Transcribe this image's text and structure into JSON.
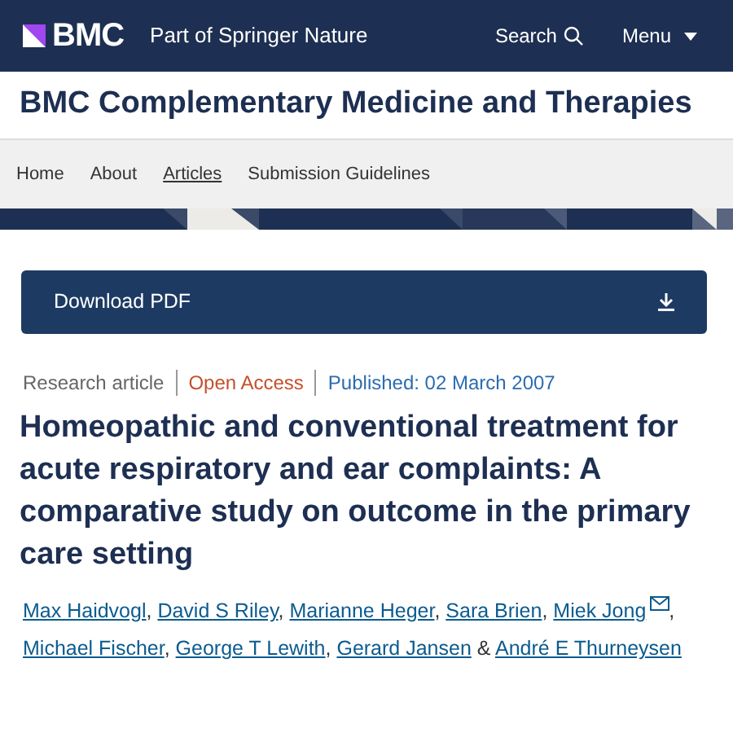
{
  "header": {
    "logo": "BMC",
    "tagline": "Part of Springer Nature",
    "search": "Search",
    "menu": "Menu"
  },
  "journal_title": "BMC Complementary Medicine and Therapies",
  "nav": [
    {
      "label": "Home",
      "selected": false
    },
    {
      "label": "About",
      "selected": false
    },
    {
      "label": "Articles",
      "selected": true
    },
    {
      "label": "Submission Guidelines",
      "selected": false
    }
  ],
  "download_button": "Download PDF",
  "meta": [
    {
      "kind": "type",
      "text": "Research article"
    },
    {
      "kind": "access",
      "text": "Open Access"
    },
    {
      "kind": "date",
      "text": "Published: 02 March 2007"
    }
  ],
  "article_title": "Homeopathic and conventional treatment for acute respiratory and ear complaints: A comparative study on outcome in the primary care setting",
  "authors": [
    {
      "name": "Max Haidvogl",
      "email": false,
      "separator": ","
    },
    {
      "name": "David S Riley",
      "email": false,
      "separator": ","
    },
    {
      "name": "Marianne Heger",
      "email": false,
      "separator": ","
    },
    {
      "name": "Sara Brien",
      "email": false,
      "separator": ","
    },
    {
      "name": "Miek Jong",
      "email": true,
      "separator": ","
    },
    {
      "name": "Michael Fischer",
      "email": false,
      "separator": ","
    },
    {
      "name": "George T Lewith",
      "email": false,
      "separator": ","
    },
    {
      "name": "Gerard Jansen",
      "email": false,
      "separator": "&"
    },
    {
      "name": "André E Thurneysen",
      "email": false
    }
  ]
}
